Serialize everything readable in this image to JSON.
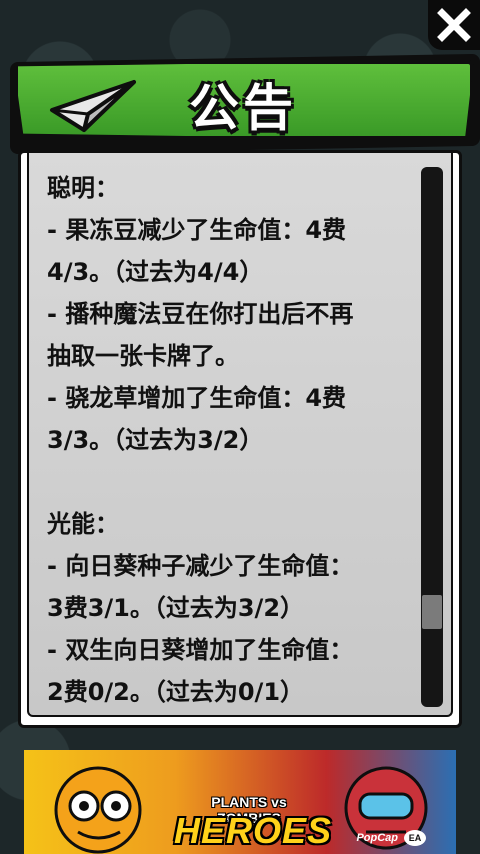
{
  "header": {
    "title": "公告"
  },
  "close_icon": "close-x-icon",
  "header_icon": "paper-plane-icon",
  "announcement": {
    "lines": [
      "聪明：",
      "- 果冻豆减少了生命值：4费",
      "4/3。（过去为4/4）",
      "- 播种魔法豆在你打出后不再",
      "抽取一张卡牌了。",
      "- 骁龙草增加了生命值：4费",
      "3/3。（过去为3/2）",
      "",
      "光能：",
      "- 向日葵种子减少了生命值：",
      "3费3/1。（过去为3/2）",
      "- 双生向日葵增加了生命值：",
      "2费0/2。（过去为0/1）"
    ]
  },
  "ad": {
    "logo_top": "PLANTS vs ZOMBIES",
    "logo_main": "HEROES",
    "publisher": "PopCap",
    "badge": "EA"
  },
  "colors": {
    "header_green": "#4aab31",
    "panel_bg": "#d0d0d0",
    "text": "#111111"
  }
}
